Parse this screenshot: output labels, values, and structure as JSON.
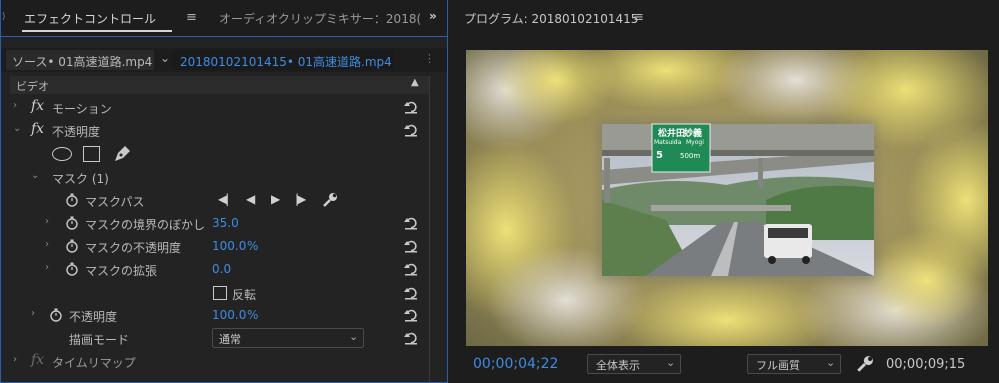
{
  "effect_controls": {
    "tab_label": "エフェクトコントロール",
    "menu_icon": "hamburger-icon",
    "audio_mixer_tab_label": "オーディオクリップミキサー：2018(",
    "overflow_icon": "double-chevron-right-icon",
    "source_label": "ソース• 01高速道路.mp4",
    "sequence_label": "20180102101415• 01高速道路.mp4",
    "section_video": "ビデオ",
    "motion_label": "モーション",
    "opacity_label": "不透明度",
    "mask_group_label": "マスク (1)",
    "mask_path_label": "マスクパス",
    "mask_feather_label": "マスクの境界のぼかし",
    "mask_feather_value": "35.0",
    "mask_opacity_label": "マスクの不透明度",
    "mask_opacity_value": "100.0",
    "mask_opacity_unit": "%",
    "mask_expansion_label": "マスクの拡張",
    "mask_expansion_value": "0.0",
    "inverted_label": "反転",
    "opacity_prop_label": "不透明度",
    "opacity_prop_value": "100.0",
    "opacity_prop_unit": "%",
    "blend_mode_label": "描画モード",
    "blend_mode_value": "通常",
    "time_remap_label": "タイムリマップ"
  },
  "program": {
    "title": "プログラム: 20180102101415",
    "timecode": "00;00;04;22",
    "fit_value": "全体表示",
    "quality_value": "フル画質",
    "duration": "00;00;09;15",
    "sign_text_1": "松井田",
    "sign_text_2": "妙義",
    "sign_text_3": "Matsuida",
    "sign_text_4": "Myogi",
    "sign_exit": "5",
    "sign_dist": "500m"
  },
  "colors": {
    "accent": "#3f8ce2",
    "panel_bg": "#232323"
  }
}
